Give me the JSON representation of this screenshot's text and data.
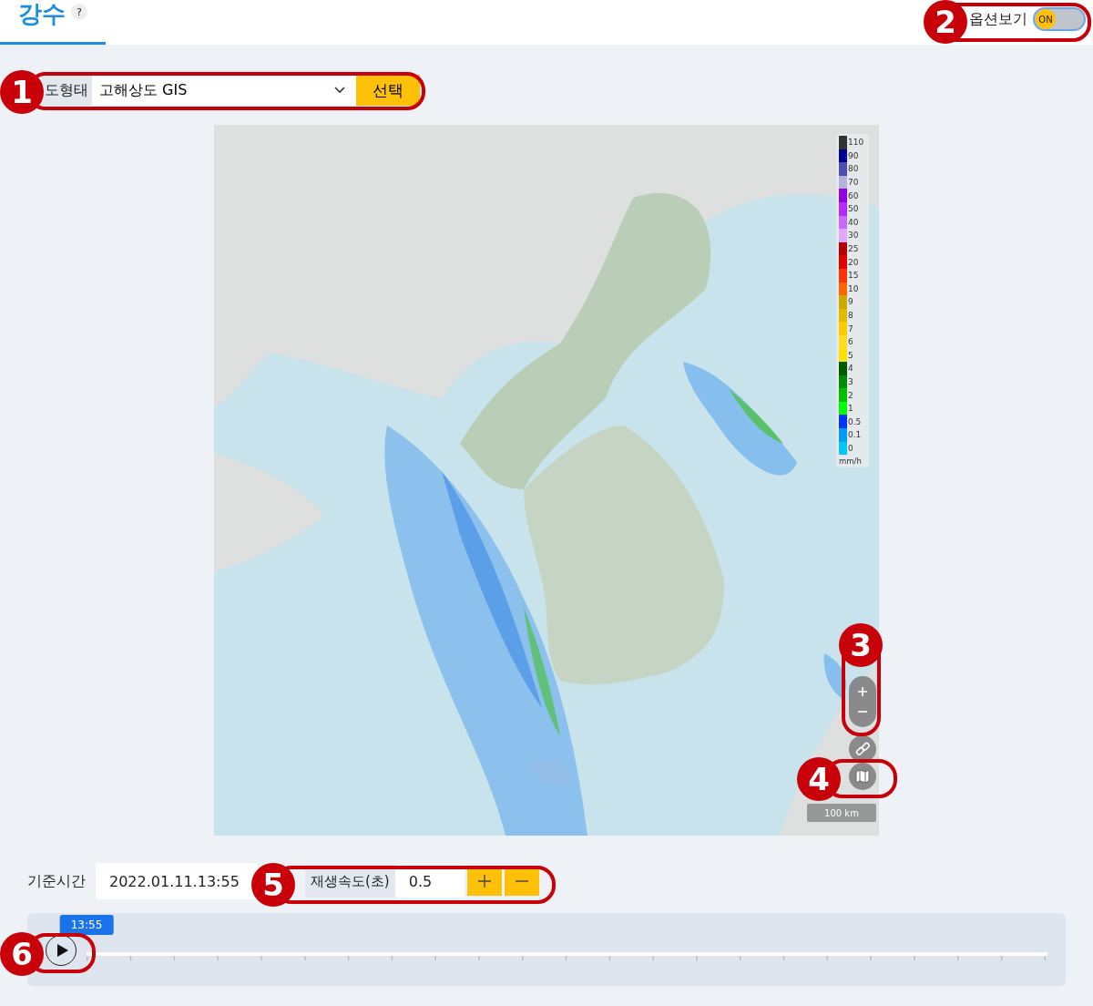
{
  "header": {
    "title": "강수",
    "help": "?"
  },
  "options_toggle": {
    "label": "옵션보기",
    "on": true,
    "text": "ON"
  },
  "map_type": {
    "label": "도형태",
    "value": "고해상도 GIS",
    "button": "선택"
  },
  "map": {
    "kind": "picture",
    "legend": {
      "items": [
        {
          "label": "110",
          "color": "#333333"
        },
        {
          "label": "90",
          "color": "#000390"
        },
        {
          "label": "80",
          "color": "#4c4eb1"
        },
        {
          "label": "70",
          "color": "#b3b4de"
        },
        {
          "label": "60",
          "color": "#9300e4"
        },
        {
          "label": "50",
          "color": "#b329ff"
        },
        {
          "label": "40",
          "color": "#c969ff"
        },
        {
          "label": "30",
          "color": "#e0a9ff"
        },
        {
          "label": "25",
          "color": "#b40000"
        },
        {
          "label": "20",
          "color": "#e00000"
        },
        {
          "label": "15",
          "color": "#ff3200"
        },
        {
          "label": "10",
          "color": "#ff6600"
        },
        {
          "label": "9",
          "color": "#ccaa00"
        },
        {
          "label": "8",
          "color": "#e0b900"
        },
        {
          "label": "7",
          "color": "#f9cd00"
        },
        {
          "label": "6",
          "color": "#ffdc1f"
        },
        {
          "label": "5",
          "color": "#ffe100"
        },
        {
          "label": "4",
          "color": "#005a00"
        },
        {
          "label": "3",
          "color": "#008c00"
        },
        {
          "label": "2",
          "color": "#00be00"
        },
        {
          "label": "1",
          "color": "#00ff00"
        },
        {
          "label": "0.5",
          "color": "#0033ff"
        },
        {
          "label": "0.1",
          "color": "#009bf5"
        },
        {
          "label": "0",
          "color": "#00c8ff"
        }
      ],
      "unit": "mm/h"
    },
    "scale": "100 km"
  },
  "time": {
    "label": "기준시간",
    "value": "2022.01.11.13:55"
  },
  "speed": {
    "label": "재생속도(초)",
    "value": "0.5"
  },
  "timeline": {
    "current": "13:55",
    "level": 0
  },
  "callouts": [
    "1",
    "2",
    "3",
    "4",
    "5",
    "6"
  ]
}
